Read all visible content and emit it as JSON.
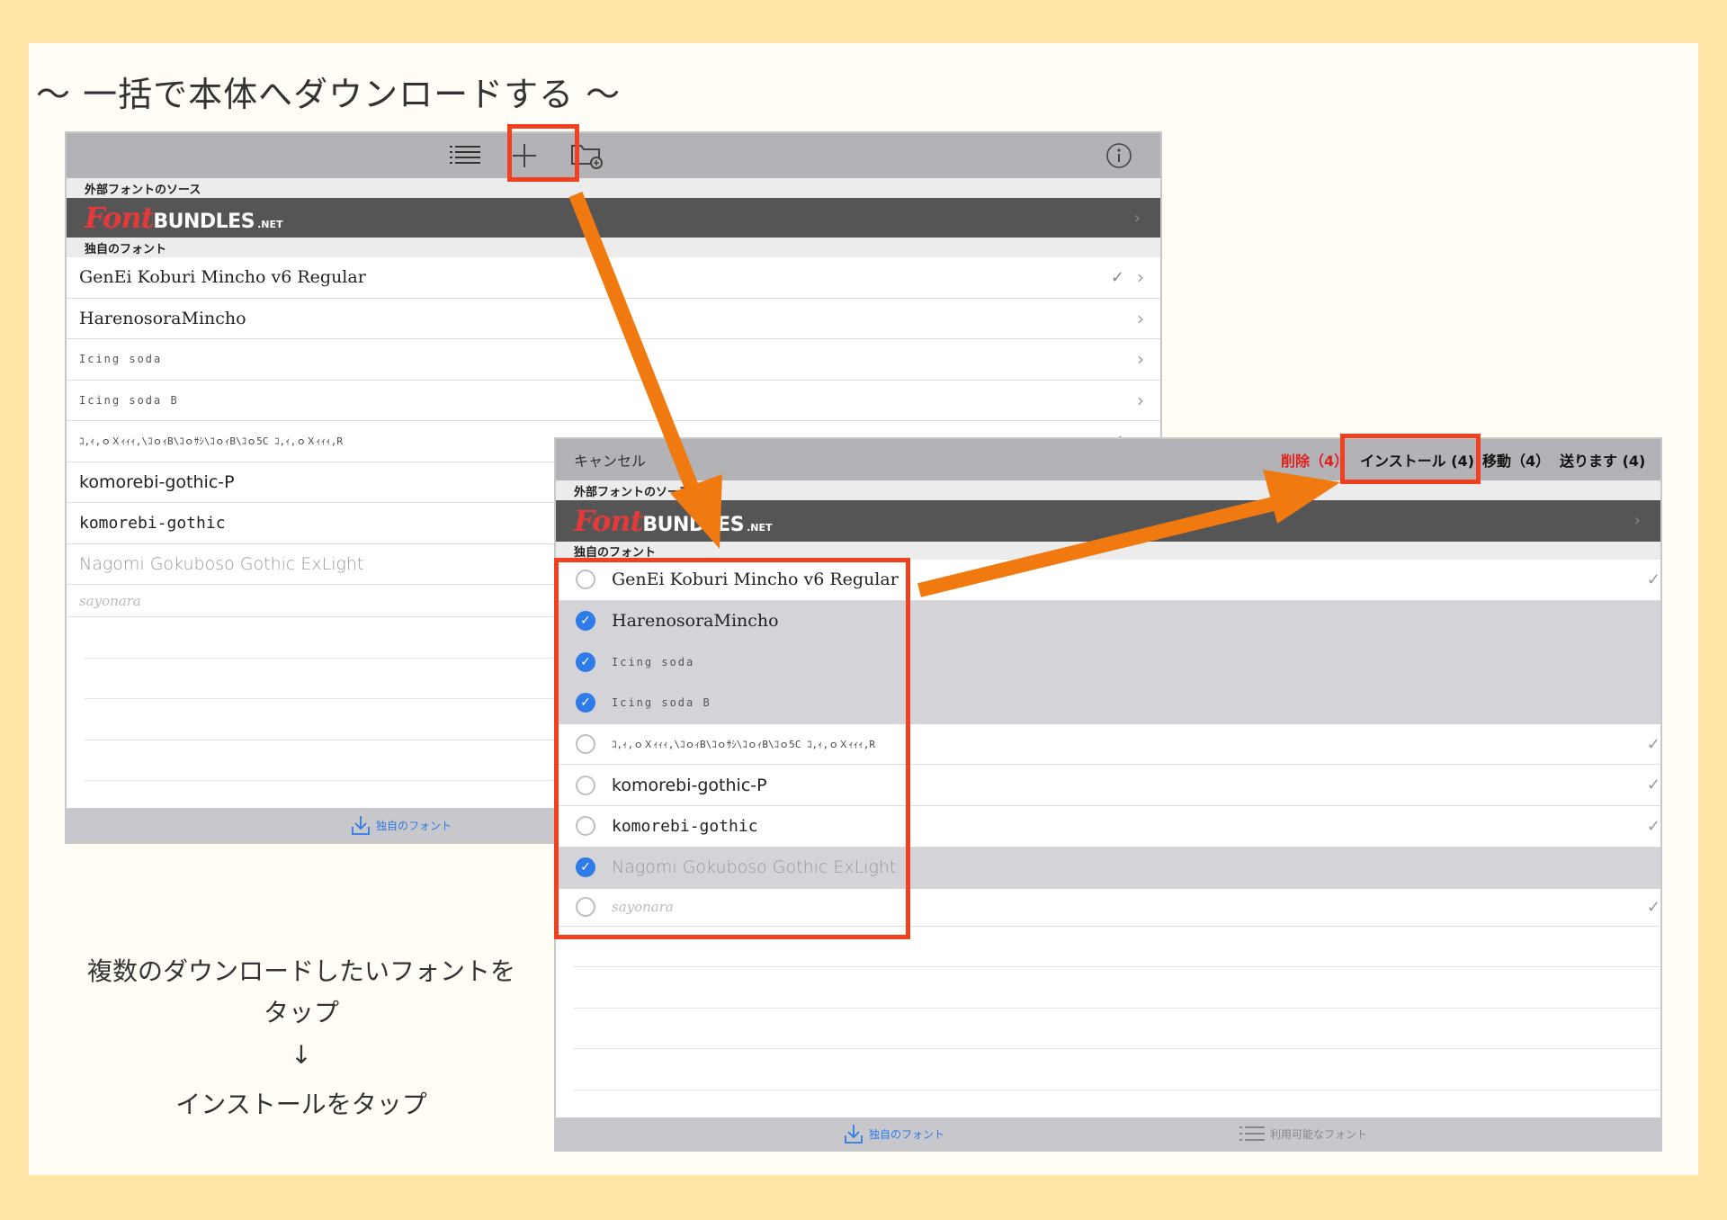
{
  "heading": "〜 一括で本体へダウンロードする 〜",
  "screenA": {
    "source_header": "外部フォントのソース",
    "logo": {
      "font": "Font",
      "bundles": "BUNDLES",
      "net": ".NET"
    },
    "own_header": "独自のフォント",
    "fonts": [
      {
        "label": "GenEi Koburi Mincho v6 Regular",
        "check": "✓"
      },
      {
        "label": "HarenosoraMincho",
        "check": ""
      },
      {
        "label": "Icing soda",
        "check": ""
      },
      {
        "label": "Icing soda B",
        "check": ""
      },
      {
        "label": "ｺ,ｨ,ｏＸｨｨｨ,\\ｺｏｨB\\ｺｏｻｼ\\ｺｏｨB\\ｺｏ5C ｺ,ｨ,ｏＸｨｨｨ,R",
        "check": "✓"
      },
      {
        "label": "komorebi-gothic-P",
        "check": ""
      },
      {
        "label": "komorebi-gothic",
        "check": ""
      },
      {
        "label": "Nagomi Gokuboso Gothic ExLight",
        "check": ""
      },
      {
        "label": "sayonara",
        "check": ""
      }
    ],
    "tab_label": "独自のフォント"
  },
  "screenB": {
    "cancel": "キャンセル",
    "delete": "削除（4）",
    "install": "インストール (4)",
    "move": "移動（4）",
    "send": "送ります (4)",
    "source_header": "外部フォントのソース",
    "own_header": "独自のフォント",
    "fonts": [
      {
        "label": "GenEi Koburi Mincho v6 Regular",
        "selected": false,
        "check": "✓"
      },
      {
        "label": "HarenosoraMincho",
        "selected": true,
        "check": ""
      },
      {
        "label": "Icing soda",
        "selected": true,
        "check": ""
      },
      {
        "label": "Icing soda B",
        "selected": true,
        "check": ""
      },
      {
        "label": "ｺ,ｨ,ｏＸｨｨｨ,\\ｺｏｨB\\ｺｏｻｼ\\ｺｏｨB\\ｺｏ5C ｺ,ｨ,ｏＸｨｨｨ,R",
        "selected": false,
        "check": "✓"
      },
      {
        "label": "komorebi-gothic-P",
        "selected": false,
        "check": "✓"
      },
      {
        "label": "komorebi-gothic",
        "selected": false,
        "check": "✓"
      },
      {
        "label": "Nagomi Gokuboso Gothic ExLight",
        "selected": true,
        "check": ""
      },
      {
        "label": "sayonara",
        "selected": false,
        "check": "✓"
      }
    ],
    "tab_own": "独自のフォント",
    "tab_available": "利用可能なフォント"
  },
  "caption": {
    "line1": "複数のダウンロードしたいフォントを",
    "line2": "タップ",
    "arrow": "↓",
    "line3": "インストールをタップ"
  },
  "colors": {
    "highlight": "#F0401F",
    "arrow": "#F07A10",
    "accent": "#2F7BE8",
    "delete": "#E0201A"
  }
}
